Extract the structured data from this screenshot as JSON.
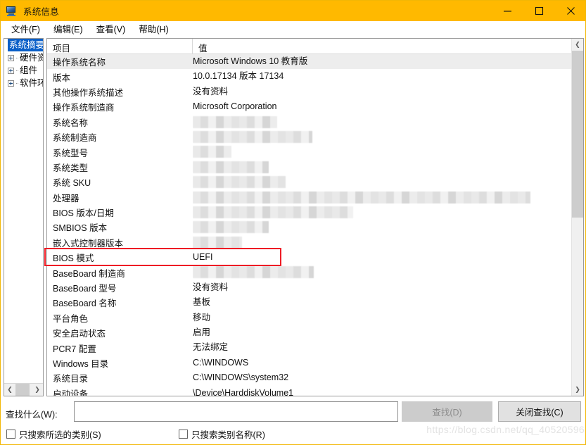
{
  "window": {
    "title": "系统信息",
    "icon": "computer-icon",
    "accent_color": "#ffb900",
    "border_color": "#f2b705",
    "buttons": {
      "minimize": "minimize-icon",
      "maximize": "maximize-icon",
      "close": "close-icon"
    }
  },
  "menubar": {
    "items": [
      {
        "label": "文件(F)"
      },
      {
        "label": "编辑(E)"
      },
      {
        "label": "查看(V)"
      },
      {
        "label": "帮助(H)"
      }
    ]
  },
  "tree": {
    "items": [
      {
        "label": "系统摘要",
        "selected": true,
        "expandable": false
      },
      {
        "label": "硬件资",
        "selected": false,
        "expandable": true
      },
      {
        "label": "组件",
        "selected": false,
        "expandable": true
      },
      {
        "label": "软件环",
        "selected": false,
        "expandable": true
      }
    ],
    "hscroll": {
      "left_arrow": "chevron-left-icon",
      "right_arrow": "chevron-right-icon"
    }
  },
  "list": {
    "columns": [
      "项目",
      "值"
    ],
    "rows": [
      {
        "item": "操作系统名称",
        "value": "Microsoft Windows 10 教育版",
        "blurred": false,
        "alt": true
      },
      {
        "item": "版本",
        "value": "10.0.17134 版本 17134",
        "blurred": false,
        "alt": false
      },
      {
        "item": "其他操作系统描述",
        "value": "没有资料",
        "blurred": false,
        "alt": false
      },
      {
        "item": "操作系统制造商",
        "value": "Microsoft Corporation",
        "blurred": false,
        "alt": false
      },
      {
        "item": "系统名称",
        "value": "",
        "blurred": true,
        "blur_width": 120,
        "alt": false
      },
      {
        "item": "系统制造商",
        "value": "",
        "blurred": true,
        "blur_width": 170,
        "alt": false
      },
      {
        "item": "系统型号",
        "value": "",
        "blurred": true,
        "blur_width": 55,
        "alt": false
      },
      {
        "item": "系统类型",
        "value": "",
        "blurred": true,
        "blur_width": 108,
        "alt": false
      },
      {
        "item": "系统 SKU",
        "value": "",
        "blurred": true,
        "blur_width": 132,
        "alt": false
      },
      {
        "item": "处理器",
        "value": "",
        "blurred": true,
        "blur_width": 480,
        "alt": false
      },
      {
        "item": "BIOS 版本/日期",
        "value": "",
        "blurred": true,
        "blur_width": 228,
        "alt": false
      },
      {
        "item": "SMBIOS 版本",
        "value": "",
        "blurred": true,
        "blur_width": 108,
        "alt": false
      },
      {
        "item": "嵌入式控制器版本",
        "value": "",
        "blurred": true,
        "blur_width": 70,
        "alt": false
      },
      {
        "item": "BIOS 模式",
        "value": "UEFI",
        "blurred": false,
        "alt": false,
        "highlighted": true
      },
      {
        "item": "BaseBoard 制造商",
        "value": "",
        "blurred": true,
        "blur_width": 172,
        "alt": false
      },
      {
        "item": "BaseBoard 型号",
        "value": "没有资料",
        "blurred": false,
        "alt": false
      },
      {
        "item": "BaseBoard 名称",
        "value": "基板",
        "blurred": false,
        "alt": false
      },
      {
        "item": "平台角色",
        "value": "移动",
        "blurred": false,
        "alt": false
      },
      {
        "item": "安全启动状态",
        "value": "启用",
        "blurred": false,
        "alt": false
      },
      {
        "item": "PCR7 配置",
        "value": "无法绑定",
        "blurred": false,
        "alt": false
      },
      {
        "item": "Windows 目录",
        "value": "C:\\WINDOWS",
        "blurred": false,
        "alt": false
      },
      {
        "item": "系统目录",
        "value": "C:\\WINDOWS\\system32",
        "blurred": false,
        "alt": false
      },
      {
        "item": "启动设备",
        "value": "\\Device\\HarddiskVolume1",
        "blurred": false,
        "alt": false
      }
    ],
    "vscroll": {
      "up_arrow": "chevron-up-icon",
      "down_arrow": "chevron-down-icon"
    }
  },
  "highlight": {
    "color": "#ee1c25",
    "target_row": "BIOS 模式"
  },
  "findbar": {
    "label": "查找什么(W):",
    "input_value": "",
    "find_button": "查找(D)",
    "find_button_enabled": false,
    "close_button": "关闭查找(C)",
    "checkbox_selected_category": "只搜索所选的类别(S)",
    "checkbox_category_name": "只搜索类别名称(R)",
    "checkbox_selected_category_checked": false,
    "checkbox_category_name_checked": false
  },
  "watermark": "https://blog.csdn.net/qq_40520596"
}
